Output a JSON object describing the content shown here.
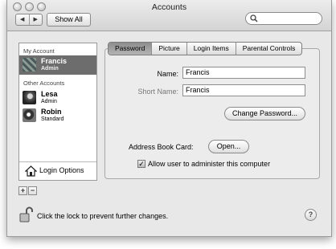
{
  "window": {
    "title": "Accounts"
  },
  "toolbar": {
    "back": "◀",
    "forward": "▶",
    "show_all_label": "Show All",
    "search_placeholder": ""
  },
  "sidebar": {
    "my_account_header": "My Account",
    "other_accounts_header": "Other Accounts",
    "accounts": [
      {
        "name": "Francis",
        "role": "Admin"
      },
      {
        "name": "Lesa",
        "role": "Admin"
      },
      {
        "name": "Robin",
        "role": "Standard"
      }
    ],
    "login_options_label": "Login Options",
    "add_label": "+",
    "remove_label": "−"
  },
  "tabs": [
    "Password",
    "Picture",
    "Login Items",
    "Parental Controls"
  ],
  "password_pane": {
    "name_label": "Name:",
    "name_value": "Francis",
    "short_name_label": "Short Name:",
    "short_name_value": "Francis",
    "change_password_label": "Change Password...",
    "address_book_label": "Address Book Card:",
    "open_label": "Open...",
    "admin_checkbox_label": "Allow user to administer this computer",
    "admin_checked": true
  },
  "footer": {
    "lock_text": "Click the lock to prevent further changes.",
    "help_label": "?"
  }
}
